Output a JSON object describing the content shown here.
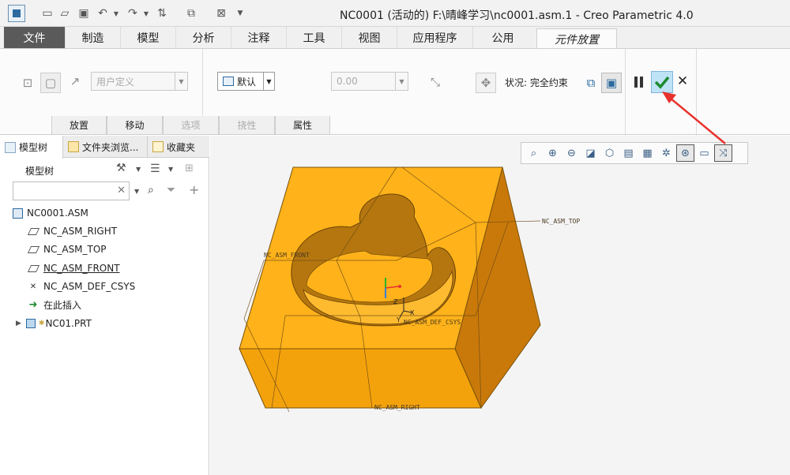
{
  "window": {
    "title": "NC0001 (活动的) F:\\晴峰学习\\nc0001.asm.1 - Creo Parametric 4.0"
  },
  "ribbon_tabs": [
    {
      "label": "文件"
    },
    {
      "label": "制造"
    },
    {
      "label": "模型"
    },
    {
      "label": "分析"
    },
    {
      "label": "注释"
    },
    {
      "label": "工具"
    },
    {
      "label": "视图"
    },
    {
      "label": "应用程序"
    },
    {
      "label": "公用"
    },
    {
      "label": "元件放置"
    }
  ],
  "placement": {
    "constraint_combo": "用户定义",
    "default_combo": "默认",
    "offset_value": "0.00",
    "status": "状况: 完全约束"
  },
  "subtabs": [
    {
      "label": "放置"
    },
    {
      "label": "移动"
    },
    {
      "label": "选项"
    },
    {
      "label": "挠性"
    },
    {
      "label": "属性"
    }
  ],
  "panel": {
    "tabs": [
      {
        "label": "模型树"
      },
      {
        "label": "文件夹浏览..."
      },
      {
        "label": "收藏夹"
      }
    ],
    "tree_title": "模型树",
    "search_placeholder": "",
    "items": [
      {
        "label": "NC0001.ASM"
      },
      {
        "label": "NC_ASM_RIGHT"
      },
      {
        "label": "NC_ASM_TOP"
      },
      {
        "label": "NC_ASM_FRONT"
      },
      {
        "label": "NC_ASM_DEF_CSYS"
      },
      {
        "label": "在此插入"
      },
      {
        "label": "NC01.PRT"
      }
    ]
  },
  "viewport": {
    "labels": {
      "top": "NC_ASM_TOP",
      "front": "NC_ASM_FRONT",
      "right": "NC_ASM_RIGHT",
      "csys": "NC_ASM_DEF_CSYS",
      "axis_z": "Z",
      "axis_y": "Y",
      "axis_x": "X"
    },
    "colors": {
      "top_face": "#ffb21a",
      "front_face": "#f4a20c",
      "right_face": "#c9790a",
      "pocket_wall": "#b5760f",
      "arrow": "#e8322d",
      "ok_button": "#bfe3f6"
    }
  }
}
